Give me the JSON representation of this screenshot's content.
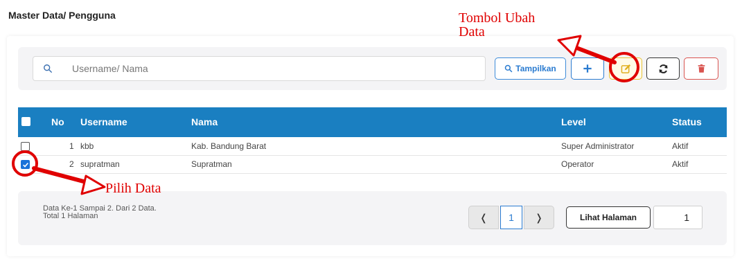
{
  "page": {
    "title": "Master Data/ Pengguna"
  },
  "search": {
    "placeholder": "Username/ Nama",
    "value": ""
  },
  "toolbar": {
    "show_label": "Tampilkan",
    "add_icon": "plus-icon",
    "edit_icon": "edit-icon",
    "refresh_icon": "refresh-icon",
    "delete_icon": "trash-icon"
  },
  "table": {
    "columns": [
      "No",
      "Username",
      "Nama",
      "Level",
      "Status"
    ],
    "rows": [
      {
        "checked": false,
        "no": "1",
        "username": "kbb",
        "nama": "Kab. Bandung Barat",
        "level": "Super Administrator",
        "status": "Aktif"
      },
      {
        "checked": true,
        "no": "2",
        "username": "supratman",
        "nama": "Supratman",
        "level": "Operator",
        "status": "Aktif"
      }
    ]
  },
  "footer": {
    "info_line1": "Data Ke-1 Sampai 2. Dari 2 Data.",
    "info_line2": "Total 1 Halaman",
    "prev": "❬",
    "current_page": "1",
    "next": "❭",
    "goto_label": "Lihat Halaman",
    "goto_value": "1"
  },
  "annotations": {
    "edit_line1": "Tombol Ubah",
    "edit_line2": "Data",
    "select": "Pilih Data"
  },
  "colors": {
    "header": "#1a7fc1",
    "primary": "#2a7bd0",
    "edit": "#e8c33a",
    "delete": "#d9534f",
    "annotation": "#e00000"
  }
}
